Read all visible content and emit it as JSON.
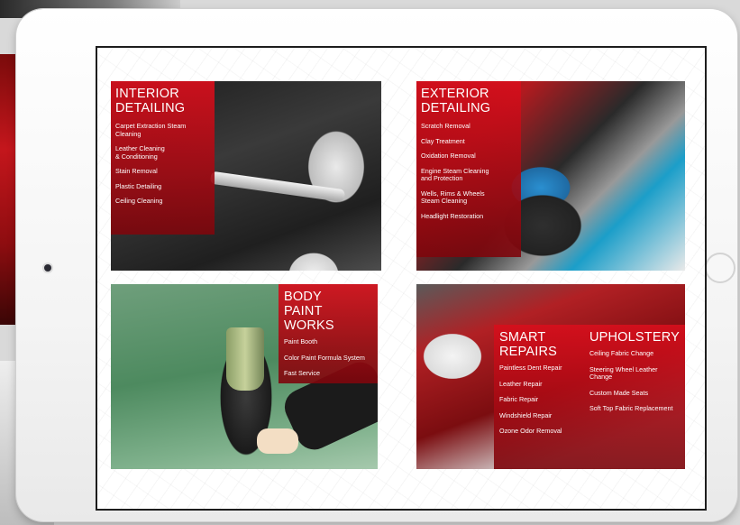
{
  "services": {
    "interior": {
      "title": "INTERIOR\nDETAILING",
      "items": [
        "Carpet Extraction Steam\nCleaning",
        "Leather Cleaning\n& Conditioning",
        "Stain Removal",
        "Plastic Detailing",
        "Ceiling Cleaning"
      ]
    },
    "exterior": {
      "title": "EXTERIOR\nDETAILING",
      "items": [
        "Scratch Removal",
        "Clay Treatment",
        "Oxidation Removal",
        "Engine Steam Cleaning\nand Protection",
        "Wells, Rims & Wheels\nSteam Cleaning",
        "Headlight Restoration"
      ]
    },
    "body_paint": {
      "title": "BODY\nPAINT WORKS",
      "items": [
        "Paint Booth",
        "Color Paint Formula System",
        "Fast Service"
      ]
    },
    "smart_repairs": {
      "title": "SMART\nREPAIRS",
      "items": [
        "Paintless Dent Repair",
        "Leather Repair",
        "Fabric Repair",
        "Windshield Repair",
        "Ozone Odor Removal"
      ]
    },
    "upholstery": {
      "title": "UPHOLSTERY",
      "items": [
        "Ceiling Fabric Change",
        "Steering Wheel Leather\nChange",
        "Custom Made Seats",
        "Soft Top Fabric Replacement"
      ]
    }
  },
  "colors": {
    "accent_red": "#d60f1c",
    "dark_red": "#7d060c",
    "device_frame": "#f4f4f4"
  },
  "icons": {
    "camera": "camera-icon",
    "home": "home-button-icon"
  }
}
